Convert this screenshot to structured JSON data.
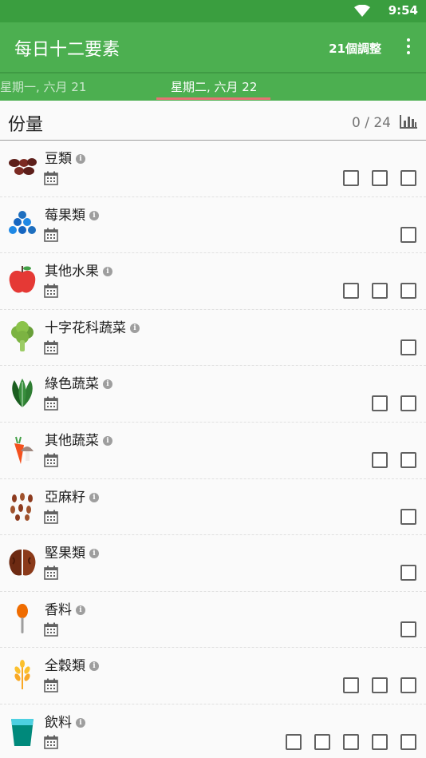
{
  "status": {
    "time": "9:54"
  },
  "appbar": {
    "title": "每日十二要素",
    "action": "21個調整"
  },
  "tabs": {
    "previous": "星期一, 六月 21",
    "current": "星期二, 六月 22"
  },
  "header": {
    "title": "份量",
    "count": "0 / 24"
  },
  "items": [
    {
      "label": "豆類",
      "boxes": [
        false,
        false,
        false
      ],
      "icon": "beans-icon"
    },
    {
      "label": "莓果類",
      "boxes": [
        false
      ],
      "icon": "berries-icon"
    },
    {
      "label": "其他水果",
      "boxes": [
        false,
        false,
        false
      ],
      "icon": "apple-icon"
    },
    {
      "label": "十字花科蔬菜",
      "boxes": [
        false
      ],
      "icon": "broccoli-icon"
    },
    {
      "label": "綠色蔬菜",
      "boxes": [
        false,
        false
      ],
      "icon": "leafy-greens-icon"
    },
    {
      "label": "其他蔬菜",
      "boxes": [
        false,
        false
      ],
      "icon": "carrot-mushroom-icon"
    },
    {
      "label": "亞麻籽",
      "boxes": [
        false
      ],
      "icon": "flaxseed-icon"
    },
    {
      "label": "堅果類",
      "boxes": [
        false
      ],
      "icon": "walnut-icon"
    },
    {
      "label": "香料",
      "boxes": [
        false
      ],
      "icon": "spice-spoon-icon"
    },
    {
      "label": "全穀類",
      "boxes": [
        false,
        false,
        false
      ],
      "icon": "wheat-icon"
    },
    {
      "label": "飲料",
      "boxes": [
        false,
        false,
        false,
        false,
        false
      ],
      "icon": "drink-cup-icon"
    }
  ]
}
